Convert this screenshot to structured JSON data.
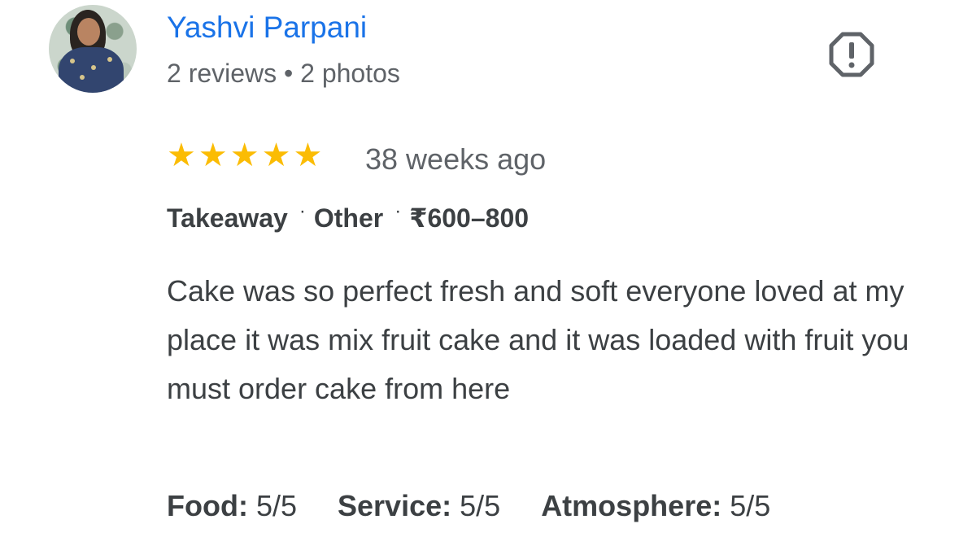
{
  "reviewer": {
    "name": "Yashvi Parpani",
    "reviews": "2 reviews",
    "separator": "•",
    "photos": "2 photos",
    "avatar_icon": "user-avatar-photo"
  },
  "review": {
    "rating": 5,
    "rating_max": 5,
    "star_glyph": "★",
    "star_color": "#fbbc04",
    "time": "38 weeks ago",
    "attributes": [
      "Takeaway",
      "Other",
      "₹600–800"
    ],
    "attribute_separator": "·",
    "text": "Cake was so perfect fresh and soft everyone loved at my place it was mix fruit cake and it was loaded with fruit you must order cake from here",
    "sub_ratings": [
      {
        "label": "Food:",
        "value": "5/5"
      },
      {
        "label": "Service:",
        "value": "5/5"
      },
      {
        "label": "Atmosphere:",
        "value": "5/5"
      }
    ]
  },
  "actions": {
    "report_icon": "report-octagon-icon"
  },
  "colors": {
    "name": "#1a73e8",
    "secondary_text": "#5f6368",
    "primary_text": "#3c4043"
  }
}
